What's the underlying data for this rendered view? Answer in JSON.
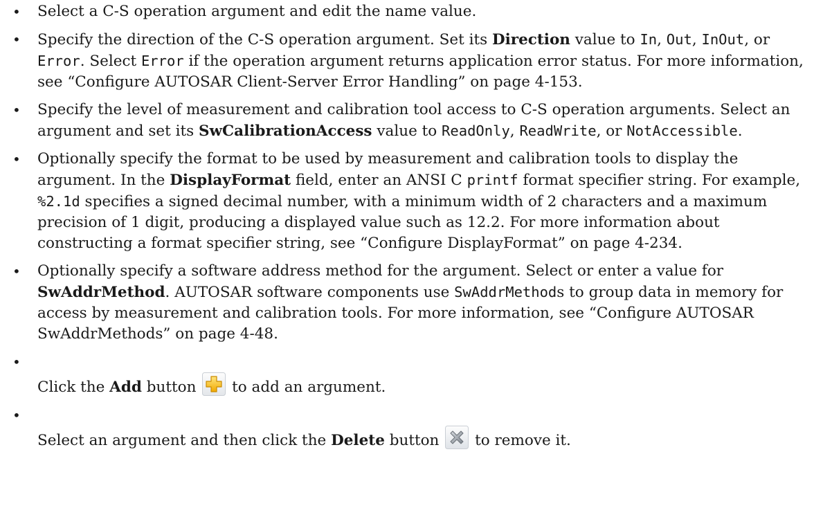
{
  "bullets": [
    {
      "parts": [
        {
          "t": "text",
          "v": "Select a C-S operation argument and edit the name value."
        }
      ]
    },
    {
      "parts": [
        {
          "t": "text",
          "v": "Specify the direction of the C-S operation argument. Set its "
        },
        {
          "t": "bold",
          "v": "Direction"
        },
        {
          "t": "text",
          "v": " value to "
        },
        {
          "t": "code",
          "v": "In"
        },
        {
          "t": "text",
          "v": ", "
        },
        {
          "t": "code",
          "v": "Out"
        },
        {
          "t": "text",
          "v": ", "
        },
        {
          "t": "code",
          "v": "InOut"
        },
        {
          "t": "text",
          "v": ", or "
        },
        {
          "t": "code",
          "v": "Error"
        },
        {
          "t": "text",
          "v": ". Select "
        },
        {
          "t": "code",
          "v": "Error"
        },
        {
          "t": "text",
          "v": " if the operation argument returns application error status. For more information, see “Configure AUTOSAR Client-Server Error Handling” on page 4-153."
        }
      ]
    },
    {
      "parts": [
        {
          "t": "text",
          "v": "Specify the level of measurement and calibration tool access to C-S operation arguments. Select an argument and set its "
        },
        {
          "t": "bold",
          "v": "SwCalibrationAccess"
        },
        {
          "t": "text",
          "v": " value to "
        },
        {
          "t": "code",
          "v": "ReadOnly"
        },
        {
          "t": "text",
          "v": ", "
        },
        {
          "t": "code",
          "v": "ReadWrite"
        },
        {
          "t": "text",
          "v": ", or "
        },
        {
          "t": "code",
          "v": "NotAccessible"
        },
        {
          "t": "text",
          "v": "."
        }
      ]
    },
    {
      "parts": [
        {
          "t": "text",
          "v": "Optionally specify the format to be used by measurement and calibration tools to display the argument. In the "
        },
        {
          "t": "bold",
          "v": "DisplayFormat"
        },
        {
          "t": "text",
          "v": " field, enter an ANSI C "
        },
        {
          "t": "code",
          "v": "printf"
        },
        {
          "t": "text",
          "v": " format specifier string. For example, "
        },
        {
          "t": "code",
          "v": "%2.1d"
        },
        {
          "t": "text",
          "v": " specifies a signed decimal number, with a minimum width of 2 characters and a maximum precision of 1 digit, producing a displayed value such as 12.2. For more information about constructing a format specifier string, see “Configure DisplayFormat” on page 4-234."
        }
      ]
    },
    {
      "parts": [
        {
          "t": "text",
          "v": "Optionally specify a software address method for the argument. Select or enter a value for "
        },
        {
          "t": "bold",
          "v": "SwAddrMethod"
        },
        {
          "t": "text",
          "v": ". AUTOSAR software components use "
        },
        {
          "t": "code",
          "v": "SwAddrMethod"
        },
        {
          "t": "text",
          "v": "s to group data in memory for access by measurement and calibration tools. For more information, see “Configure AUTOSAR SwAddrMethods” on page 4-48."
        }
      ]
    }
  ],
  "add_item": {
    "pre": "Click the ",
    "bold": "Add",
    "mid": " button ",
    "post": " to add an argument.",
    "icon": "add-icon",
    "icon_color": "#f5b800"
  },
  "delete_item": {
    "pre": "Select an argument and then click the ",
    "bold": "Delete",
    "mid": " button ",
    "post": " to remove it.",
    "icon": "delete-icon",
    "icon_color": "#8a8f96"
  },
  "bullet_glyph": "•"
}
